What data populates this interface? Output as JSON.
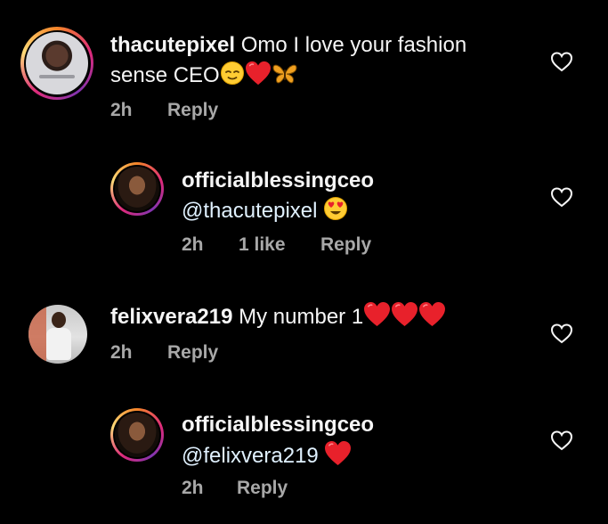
{
  "comments": [
    {
      "username": "thacutepixel",
      "text": "Omo I love your fashion",
      "text_line2": "sense CEO",
      "emojis": [
        "relieved-face",
        "red-heart",
        "butterfly"
      ],
      "time": "2h",
      "reply": "Reply"
    },
    {
      "username": "officialblessingceo",
      "mention": "@thacutepixel",
      "emojis": [
        "heart-eyes-face"
      ],
      "time": "2h",
      "likes": "1 like",
      "reply": "Reply"
    },
    {
      "username": "felixvera219",
      "text": "My number 1",
      "emojis": [
        "red-heart",
        "red-heart",
        "red-heart"
      ],
      "time": "2h",
      "reply": "Reply"
    },
    {
      "username": "officialblessingceo",
      "mention": "@felixvera219",
      "emojis": [
        "red-heart"
      ],
      "time": "2h",
      "reply": "Reply"
    }
  ],
  "colors": {
    "background": "#000000",
    "text": "#f5f5f5",
    "meta": "#a8a8a8",
    "heart": "#e8212b",
    "like_icon": "#f5f5f5"
  },
  "icons": [
    "heart-outline-icon",
    "relieved-face",
    "red-heart",
    "butterfly",
    "heart-eyes-face"
  ]
}
